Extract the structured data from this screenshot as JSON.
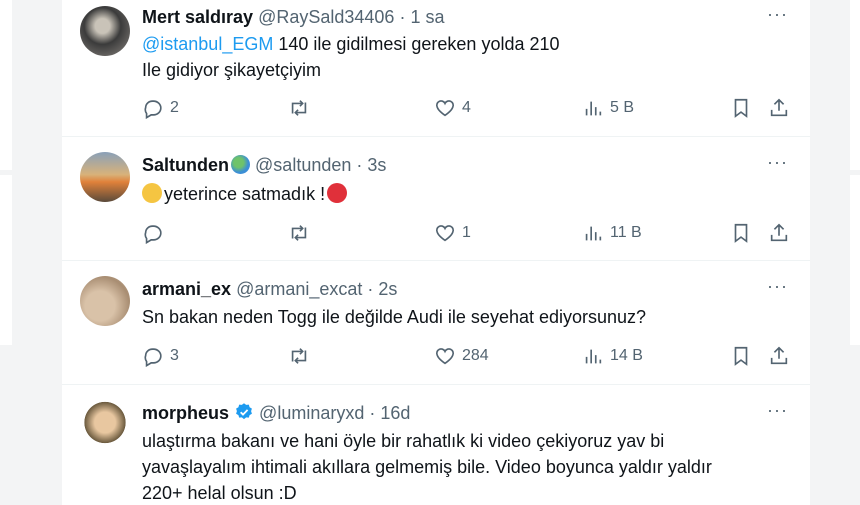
{
  "tweets": [
    {
      "name": "Mert saldıray",
      "handle": "@RaySald34406",
      "time": "1 sa",
      "mention": "@istanbul_EGM",
      "text_line1": " 140 ile gidilmesi gereken yolda 210",
      "text_line2": "Ile gidiyor şikayetçiyim",
      "replies": "2",
      "retweets": "",
      "likes": "4",
      "views": "5 B"
    },
    {
      "name": "Saltunden",
      "handle": "@saltunden",
      "time": "3s",
      "text_line1": "yeterince satmadık !",
      "replies": "",
      "retweets": "",
      "likes": "1",
      "views": "11 B"
    },
    {
      "name": "armani_ex",
      "handle": "@armani_excat",
      "time": "2s",
      "text_line1": "Sn bakan neden Togg ile değilde Audi ile seyehat ediyorsunuz?",
      "replies": "3",
      "retweets": "",
      "likes": "284",
      "views": "14 B"
    },
    {
      "name": "morpheus",
      "handle": "@luminaryxd",
      "time": "16d",
      "text_line1": "ulaştırma bakanı ve hani öyle bir rahatlık ki video çekiyoruz yav bi",
      "text_line2": "yavaşlayalım ihtimali akıllara gelmemiş bile. Video boyunca yaldır yaldır",
      "text_line3": "220+ helal olsun :D"
    }
  ],
  "ui": {
    "more": "···",
    "sep": " · "
  },
  "colors": {
    "link": "#1d9bf0",
    "muted": "#536471",
    "verified": "#1d9bf0"
  }
}
